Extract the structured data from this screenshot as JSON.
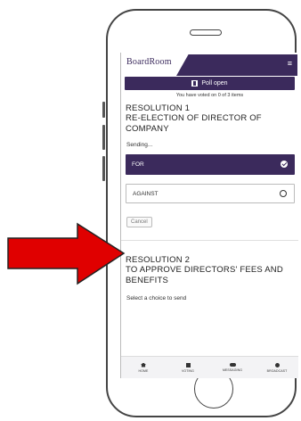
{
  "app": {
    "logo": "BoardRoom",
    "logo_sub": "",
    "menu_icon": "hamburger-icon"
  },
  "poll": {
    "icon": "poll-icon",
    "status_label": "Poll open",
    "voted_text": "You have voted on 0 of 3 items"
  },
  "resolution1": {
    "number": "RESOLUTION 1",
    "title": "RE-ELECTION OF DIRECTOR OF COMPANY",
    "status": "Sending...",
    "options": [
      {
        "label": "FOR",
        "selected": true
      },
      {
        "label": "AGAINST",
        "selected": false
      }
    ],
    "cancel_label": "Cancel"
  },
  "resolution2": {
    "number": "RESOLUTION 2",
    "title": "TO APPROVE DIRECTORS' FEES AND BENEFITS",
    "hint": "Select a choice to send"
  },
  "nav": [
    {
      "label": "HOME",
      "icon": "home-icon"
    },
    {
      "label": "VOTING",
      "icon": "voting-icon"
    },
    {
      "label": "MESSAGING",
      "icon": "messaging-icon"
    },
    {
      "label": "BROADCAST",
      "icon": "broadcast-icon"
    }
  ],
  "colors": {
    "brand": "#3b2a5c",
    "annotation_arrow": "#e00000"
  }
}
